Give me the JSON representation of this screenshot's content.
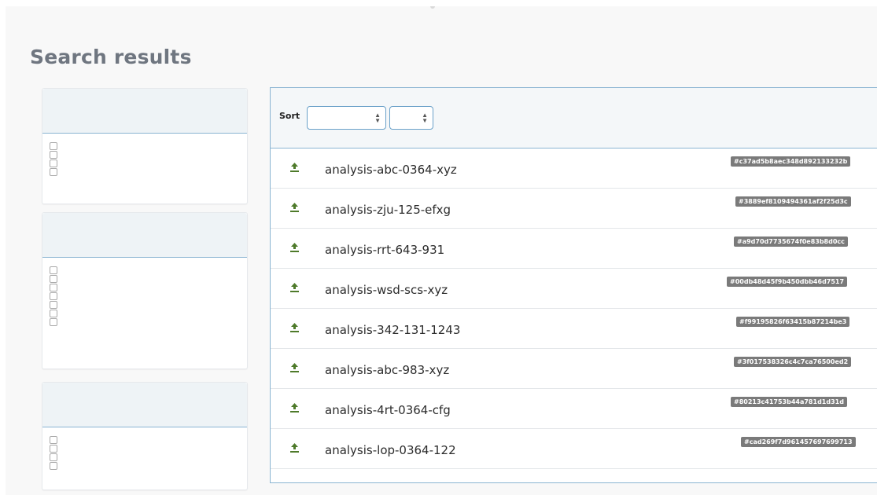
{
  "page": {
    "title": "Search results"
  },
  "facets": [
    {
      "checkbox_count": 4
    },
    {
      "checkbox_count": 7
    },
    {
      "checkbox_count": 4
    }
  ],
  "toolbar": {
    "sort_label": "Sort",
    "sort_field_value": "",
    "sort_order_value": ""
  },
  "results": [
    {
      "name": "analysis-abc-0364-xyz",
      "hash": "#c37ad5b8aec348d892133232b"
    },
    {
      "name": "analysis-zju-125-efxg",
      "hash": "#3889ef8109494361af2f25d3c"
    },
    {
      "name": "analysis-rrt-643-931",
      "hash": "#a9d70d7735674f0e83b8d0cc"
    },
    {
      "name": "analysis-wsd-scs-xyz",
      "hash": "#00db48d45f9b450dbb46d7517"
    },
    {
      "name": "analysis-342-131-1243",
      "hash": "#f99195826f63415b87214be3"
    },
    {
      "name": "analysis-abc-983-xyz",
      "hash": "#3f017538326c4c7ca76500ed2"
    },
    {
      "name": "analysis-4rt-0364-cfg",
      "hash": "#80213c41753b44a781d1d31d"
    },
    {
      "name": "analysis-lop-0364-122",
      "hash": "#cad269f7d961457697699713"
    }
  ],
  "colors": {
    "accent_border": "#8ab4d2",
    "icon_green": "#4e7a2a",
    "hash_badge": "#7a7a7a"
  },
  "icons": {
    "row_icon": "upload-icon",
    "select_arrows": "up-down-arrows-icon"
  }
}
